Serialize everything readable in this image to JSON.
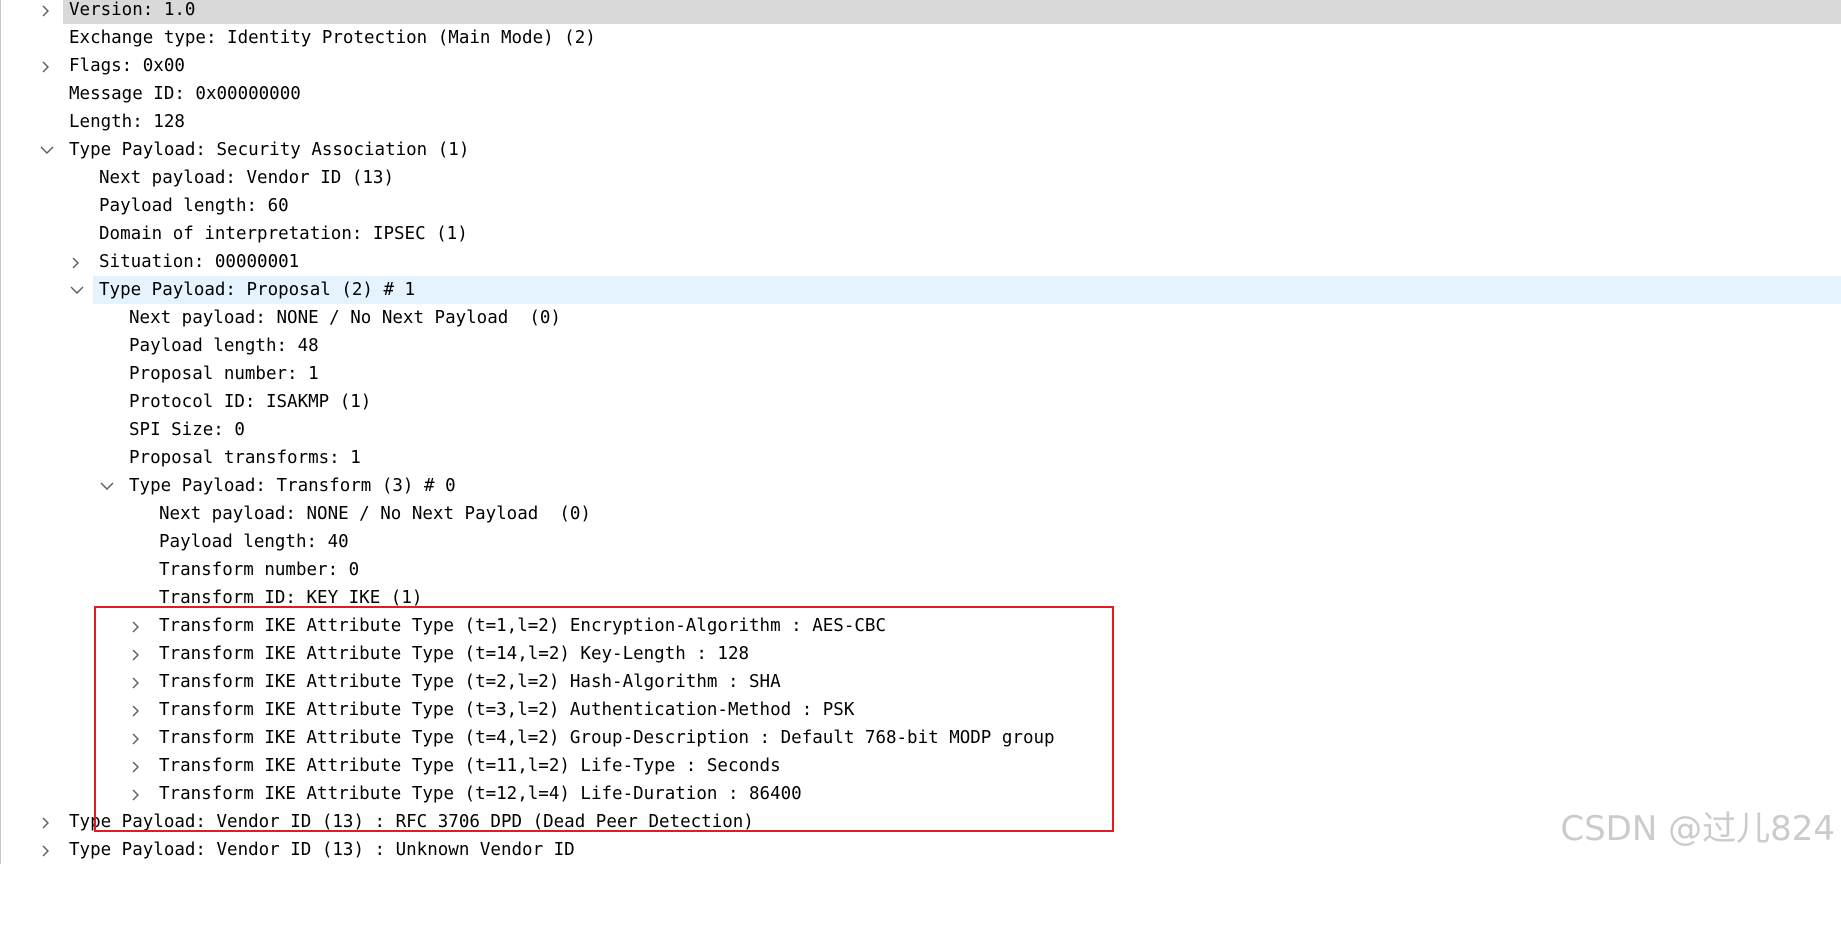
{
  "tree": {
    "rows": [
      {
        "text": "Version: 1.0",
        "arrow": "collapsed"
      },
      {
        "text": "Exchange type: Identity Protection (Main Mode) (2)",
        "arrow": "none"
      },
      {
        "text": "Flags: 0x00",
        "arrow": "collapsed"
      },
      {
        "text": "Message ID: 0x00000000",
        "arrow": "none"
      },
      {
        "text": "Length: 128",
        "arrow": "none"
      },
      {
        "text": "Type Payload: Security Association (1)",
        "arrow": "expanded"
      },
      {
        "text": "Next payload: Vendor ID (13)",
        "arrow": "none"
      },
      {
        "text": "Payload length: 60",
        "arrow": "none"
      },
      {
        "text": "Domain of interpretation: IPSEC (1)",
        "arrow": "none"
      },
      {
        "text": "Situation: 00000001",
        "arrow": "collapsed"
      },
      {
        "text": "Type Payload: Proposal (2) # 1",
        "arrow": "expanded"
      },
      {
        "text": "Next payload: NONE / No Next Payload  (0)",
        "arrow": "none"
      },
      {
        "text": "Payload length: 48",
        "arrow": "none"
      },
      {
        "text": "Proposal number: 1",
        "arrow": "none"
      },
      {
        "text": "Protocol ID: ISAKMP (1)",
        "arrow": "none"
      },
      {
        "text": "SPI Size: 0",
        "arrow": "none"
      },
      {
        "text": "Proposal transforms: 1",
        "arrow": "none"
      },
      {
        "text": "Type Payload: Transform (3) # 0",
        "arrow": "expanded"
      },
      {
        "text": "Next payload: NONE / No Next Payload  (0)",
        "arrow": "none"
      },
      {
        "text": "Payload length: 40",
        "arrow": "none"
      },
      {
        "text": "Transform number: 0",
        "arrow": "none"
      },
      {
        "text": "Transform ID: KEY_IKE (1)",
        "arrow": "none"
      },
      {
        "text": "Transform IKE Attribute Type (t=1,l=2) Encryption-Algorithm : AES-CBC",
        "arrow": "collapsed"
      },
      {
        "text": "Transform IKE Attribute Type (t=14,l=2) Key-Length : 128",
        "arrow": "collapsed"
      },
      {
        "text": "Transform IKE Attribute Type (t=2,l=2) Hash-Algorithm : SHA",
        "arrow": "collapsed"
      },
      {
        "text": "Transform IKE Attribute Type (t=3,l=2) Authentication-Method : PSK",
        "arrow": "collapsed"
      },
      {
        "text": "Transform IKE Attribute Type (t=4,l=2) Group-Description : Default 768-bit MODP group",
        "arrow": "collapsed"
      },
      {
        "text": "Transform IKE Attribute Type (t=11,l=2) Life-Type : Seconds",
        "arrow": "collapsed"
      },
      {
        "text": "Transform IKE Attribute Type (t=12,l=4) Life-Duration : 86400",
        "arrow": "collapsed"
      },
      {
        "text": "Type Payload: Vendor ID (13) : RFC 3706 DPD (Dead Peer Detection)",
        "arrow": "collapsed"
      },
      {
        "text": "Type Payload: Vendor ID (13) : Unknown Vendor ID",
        "arrow": "collapsed"
      }
    ]
  },
  "colors": {
    "row_highlight": "#e5f3ff",
    "row_selected": "#d9d9d9",
    "annotation_box": "#e01b24",
    "arrow": "#5a5a5a"
  },
  "watermark": {
    "text": "CSDN @过儿824"
  }
}
